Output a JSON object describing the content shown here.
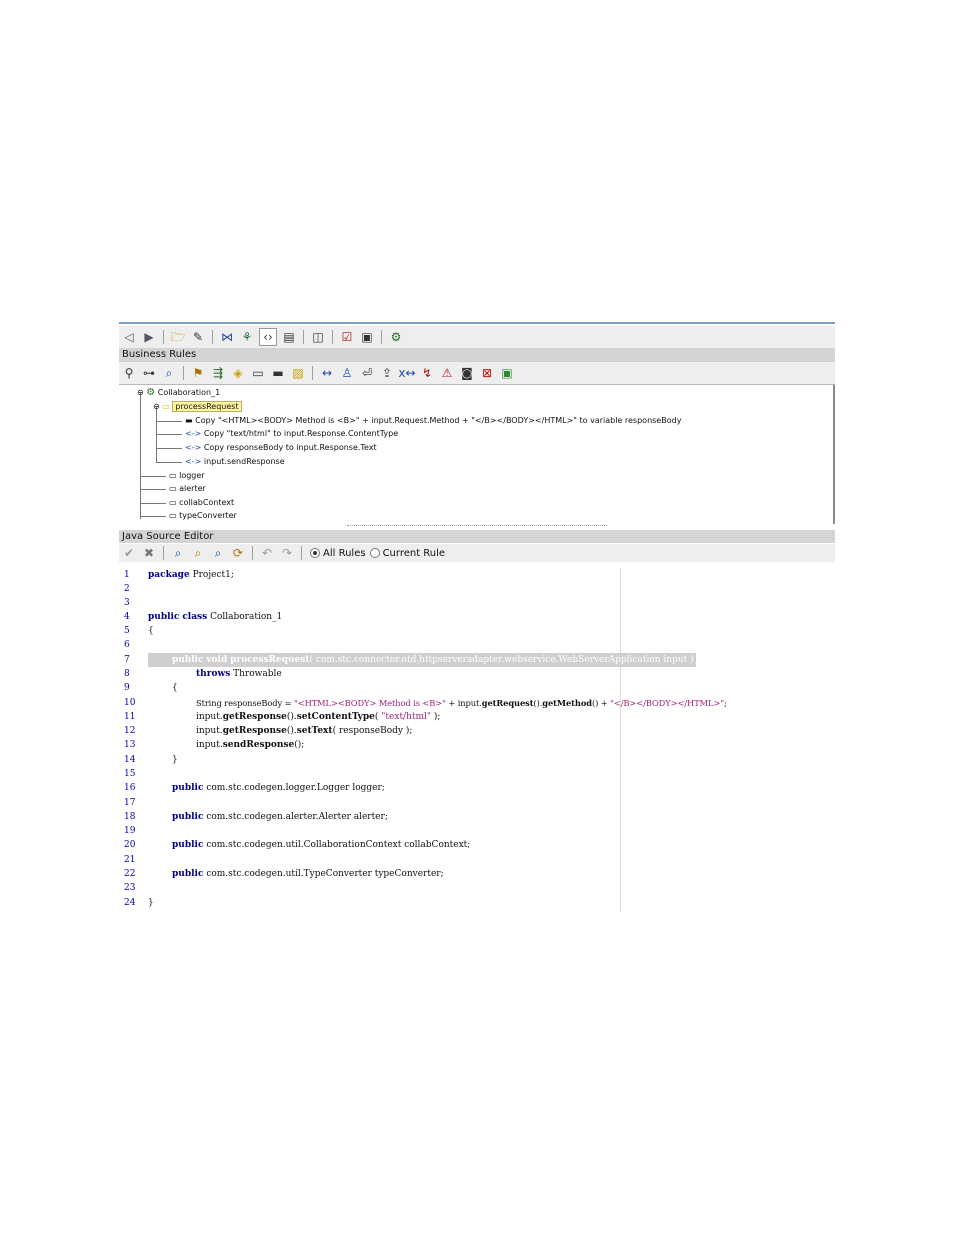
{
  "toolbar_top": {
    "icons": [
      "back-icon",
      "forward-icon",
      "open-folder-icon",
      "edit-icon",
      "merge-icon",
      "mapper-icon",
      "code-view-icon",
      "page-icon",
      "panel-icon",
      "validate-icon",
      "tester-icon",
      "deploy-icon"
    ]
  },
  "business_rules": {
    "header": "Business Rules",
    "tree": {
      "root": "Collaboration_1",
      "method": "processRequest",
      "rules": [
        "Copy \"<HTML><BODY> Method is <B>\" + input.Request.Method + \"</B></BODY></HTML>\" to variable responseBody",
        "Copy \"text/html\" to input.Response.ContentType",
        "Copy responseBody to input.Response.Text",
        "input.sendResponse"
      ],
      "fields": [
        "logger",
        "alerter",
        "collabContext",
        "typeConverter"
      ]
    }
  },
  "java_editor": {
    "header": "Java Source Editor",
    "radio_all": "All Rules",
    "radio_current": "Current Rule",
    "selected": "All Rules"
  },
  "code_lines": {
    "n": [
      "1",
      "2",
      "3",
      "4",
      "5",
      "6",
      "7",
      "8",
      "9",
      "10",
      "11",
      "12",
      "13",
      "14",
      "15",
      "16",
      "17",
      "18",
      "19",
      "20",
      "21",
      "22",
      "23",
      "24"
    ],
    "l1_kw": "package",
    "l1_rest": " Project1;",
    "l4_kw1": "public",
    "l4_kw2": "class",
    "l4_rest": " Collaboration_1",
    "l5": "{",
    "l7_kw1": "public",
    "l7_kw2": "void",
    "l7_method": "processRequest",
    "l7_rest": "( com.stc.connector.otd.httpserveradapter.webservice.WebServerApplication input )",
    "l8_kw": "throws",
    "l8_rest": " Throwable",
    "l9": "{",
    "l10_a": "String responseBody = ",
    "l10_s1": "\"<HTML><BODY> Method is <B>\"",
    "l10_b": " + input.",
    "l10_m1": "getRequest",
    "l10_c": "().",
    "l10_m2": "getMethod",
    "l10_d": "() + ",
    "l10_s2": "\"</B></BODY></HTML>\"",
    "l10_e": ";",
    "l11_a": "input.",
    "l11_m1": "getResponse",
    "l11_b": "().",
    "l11_m2": "setContentType",
    "l11_c": "( ",
    "l11_s": "\"text/html\"",
    "l11_d": " );",
    "l12_a": "input.",
    "l12_m1": "getResponse",
    "l12_b": "().",
    "l12_m2": "setText",
    "l12_c": "( responseBody );",
    "l13_a": "input.",
    "l13_m": "sendResponse",
    "l13_b": "();",
    "l14": "}",
    "l16_kw": "public",
    "l16_rest": " com.stc.codegen.logger.Logger logger;",
    "l18_kw": "public",
    "l18_rest": " com.stc.codegen.alerter.Alerter alerter;",
    "l20_kw": "public",
    "l20_rest": " com.stc.codegen.util.CollaborationContext collabContext;",
    "l22_kw": "public",
    "l22_rest": " com.stc.codegen.util.TypeConverter typeConverter;",
    "l24": "}"
  }
}
